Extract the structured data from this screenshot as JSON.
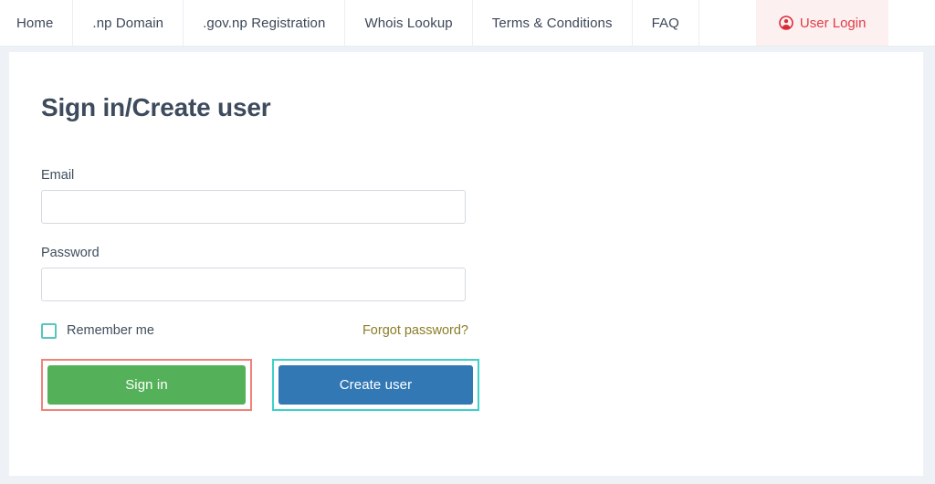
{
  "navbar": {
    "items": [
      {
        "label": "Home",
        "name": "nav-item-home"
      },
      {
        "label": ".np Domain",
        "name": "nav-item-np-domain"
      },
      {
        "label": ".gov.np Registration",
        "name": "nav-item-gov-np-registration"
      },
      {
        "label": "Whois Lookup",
        "name": "nav-item-whois-lookup"
      },
      {
        "label": "Terms & Conditions",
        "name": "nav-item-terms-conditions"
      },
      {
        "label": "FAQ",
        "name": "nav-item-faq"
      }
    ],
    "user_login": {
      "label": "User Login",
      "icon": "user-circle-icon",
      "text_color": "#e03c46",
      "background_color": "#fdf0f0"
    }
  },
  "main": {
    "title": "Sign in/Create user",
    "form": {
      "email": {
        "label": "Email",
        "value": "",
        "placeholder": ""
      },
      "password": {
        "label": "Password",
        "value": "",
        "placeholder": ""
      },
      "remember_me": {
        "label": "Remember me",
        "checked": false,
        "checkbox_border_color": "#56c6c0"
      },
      "forgot_password": {
        "label": "Forgot password?",
        "color": "#8a7d26"
      },
      "buttons": [
        {
          "label": "Sign in",
          "name": "sign-in-button",
          "background_color": "#55b159",
          "highlight_color": "#ef8379"
        },
        {
          "label": "Create user",
          "name": "create-user-button",
          "background_color": "#3278b5",
          "highlight_color": "#3fd0c9"
        }
      ]
    }
  },
  "theme": {
    "page_background": "#eef2f7",
    "card_background": "#ffffff",
    "text_color": "#3d4b5c"
  }
}
